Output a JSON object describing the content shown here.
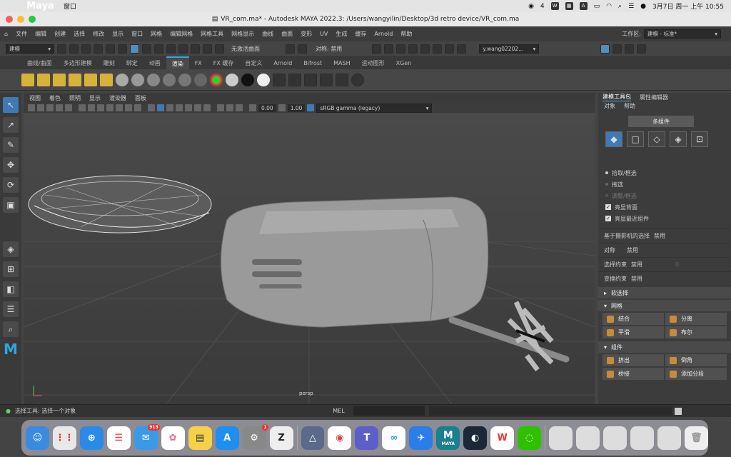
{
  "mac_menu": {
    "app": "Maya",
    "window": "窗口",
    "date_time": "3月7日 周一 上午 10:55",
    "badge_count": "4"
  },
  "title": "VR_com.ma* - Autodesk MAYA 2022.3: /Users/wangyilin/Desktop/3d retro device/VR_com.ma",
  "main_menu": [
    "文件",
    "编辑",
    "创建",
    "选择",
    "修改",
    "显示",
    "窗口",
    "网格",
    "编辑网格",
    "网格工具",
    "网格显示",
    "曲线",
    "曲面",
    "变形",
    "UV",
    "生成",
    "缓存",
    "Arnold",
    "帮助"
  ],
  "workspace": {
    "label": "工作区:",
    "value": "建模 - 标准*"
  },
  "statusline": {
    "mode": "建模",
    "no_live": "无激活曲面",
    "symmetry": "对称: 禁用",
    "user": "y.wang02202..."
  },
  "shelf_tabs": [
    "曲线/曲面",
    "多边形建模",
    "雕刻",
    "绑定",
    "动画",
    "渲染",
    "FX",
    "FX 缓存",
    "自定义",
    "Arnold",
    "Bifrost",
    "MASH",
    "运动图形",
    "XGen"
  ],
  "active_shelf": "渲染",
  "viewport": {
    "menu": [
      "视图",
      "着色",
      "照明",
      "显示",
      "渲染器",
      "面板"
    ],
    "val1": "0.00",
    "val2": "1.00",
    "colorspace": "sRGB gamma (legacy)",
    "camera": "persp"
  },
  "panel": {
    "tabs": [
      "建模工具包",
      "属性编辑器"
    ],
    "submenu": [
      "对象",
      "帮助"
    ],
    "multi_component": "多组件",
    "options": [
      "拾取/框选",
      "拖选",
      "调整/框选"
    ],
    "checks": [
      "亮显背面",
      "亮显最近组件"
    ],
    "camera_select": "基于摄影机的选择",
    "camera_select_val": "禁用",
    "symmetry": "对称",
    "symmetry_val": "禁用",
    "select_constraint": "选择约束",
    "select_constraint_val": "禁用",
    "select_constraint_num": "0",
    "transform_constraint": "变换约束",
    "transform_constraint_val": "禁用",
    "soft_select": "软选择",
    "mesh_section": "网格",
    "mesh_tools": [
      "结合",
      "分离",
      "平滑",
      "布尔"
    ],
    "component_section": "组件",
    "component_tools": [
      "挤出",
      "倒角",
      "桥接",
      "添加分段"
    ]
  },
  "help_line": "选择工具: 选择一个对象",
  "mel_label": "MEL",
  "dock": {
    "mail_badge": "913",
    "settings_badge": "1",
    "maya_label": "MAYA"
  },
  "colors": {
    "accent": "#2ea6e1",
    "selected": "#3f7ab5"
  }
}
